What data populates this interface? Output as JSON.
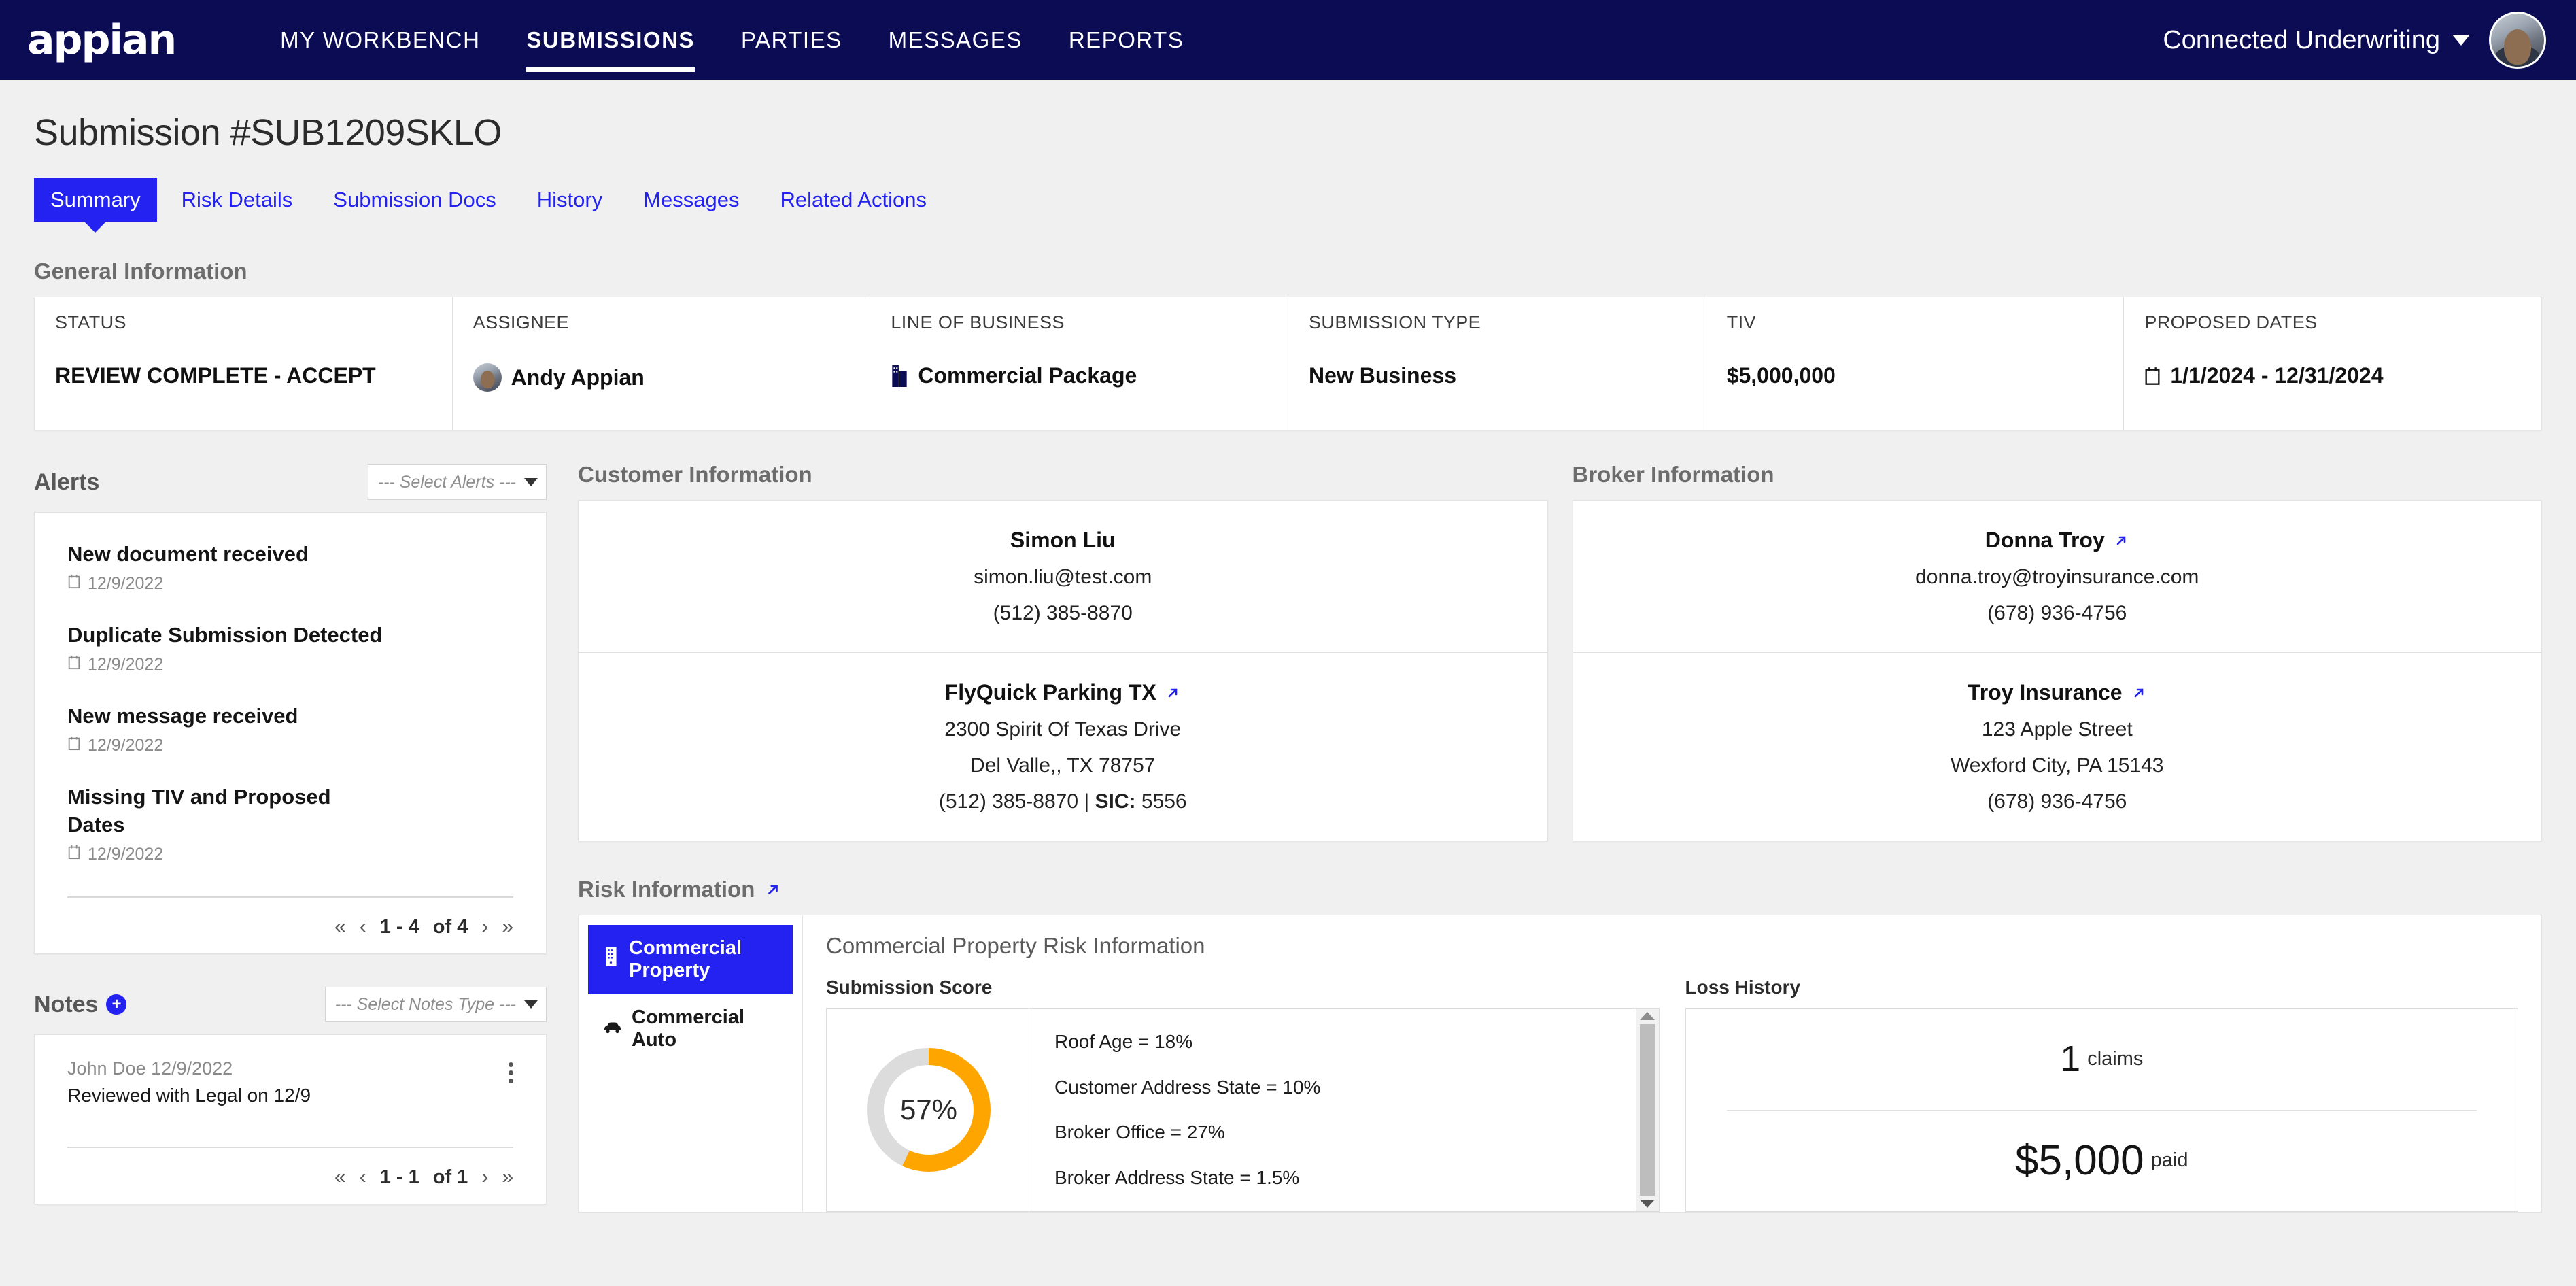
{
  "topnav": {
    "brand": "appian",
    "links": [
      {
        "label": "MY WORKBENCH",
        "active": false
      },
      {
        "label": "SUBMISSIONS",
        "active": true
      },
      {
        "label": "PARTIES",
        "active": false
      },
      {
        "label": "MESSAGES",
        "active": false
      },
      {
        "label": "REPORTS",
        "active": false
      }
    ],
    "user": "Connected Underwriting"
  },
  "page": {
    "title": "Submission #SUB1209SKLO",
    "tabs": [
      {
        "label": "Summary",
        "active": true
      },
      {
        "label": "Risk Details",
        "active": false
      },
      {
        "label": "Submission Docs",
        "active": false
      },
      {
        "label": "History",
        "active": false
      },
      {
        "label": "Messages",
        "active": false
      },
      {
        "label": "Related Actions",
        "active": false
      }
    ]
  },
  "general_information": {
    "heading": "General Information",
    "fields": [
      {
        "label": "STATUS",
        "value": "REVIEW COMPLETE - ACCEPT",
        "icon": ""
      },
      {
        "label": "ASSIGNEE",
        "value": "Andy Appian",
        "icon": "avatar"
      },
      {
        "label": "LINE OF BUSINESS",
        "value": "Commercial Package",
        "icon": "building-icon"
      },
      {
        "label": "SUBMISSION TYPE",
        "value": "New Business",
        "icon": ""
      },
      {
        "label": "TIV",
        "value": "$5,000,000",
        "icon": ""
      },
      {
        "label": "PROPOSED DATES",
        "value": "1/1/2024 - 12/31/2024",
        "icon": "calendar-icon"
      }
    ]
  },
  "alerts": {
    "title": "Alerts",
    "select_placeholder": "--- Select Alerts ---",
    "items": [
      {
        "title": "New document received",
        "date": "12/9/2022"
      },
      {
        "title": "Duplicate Submission Detected",
        "date": "12/9/2022"
      },
      {
        "title": "New message received",
        "date": "12/9/2022"
      },
      {
        "title": "Missing TIV and Proposed Dates",
        "date": "12/9/2022"
      }
    ],
    "pager": {
      "range": "1 - 4",
      "of": "of 4"
    }
  },
  "notes": {
    "title": "Notes",
    "select_placeholder": "--- Select Notes Type ---",
    "items": [
      {
        "meta": "John Doe 12/9/2022",
        "body": "Reviewed with Legal on 12/9"
      }
    ],
    "pager": {
      "range": "1 - 1",
      "of": "of 1"
    }
  },
  "customer_information": {
    "heading": "Customer Information",
    "contact": {
      "name": "Simon Liu",
      "email": "simon.liu@test.com",
      "phone": "(512) 385-8870"
    },
    "company": {
      "name": "FlyQuick Parking TX",
      "address1": "2300 Spirit Of Texas Drive",
      "address2": "Del Valle,, TX 78757",
      "phone": "(512) 385-8870",
      "sic_label": "SIC:",
      "sic_value": "5556"
    }
  },
  "broker_information": {
    "heading": "Broker Information",
    "contact": {
      "name": "Donna Troy",
      "email": "donna.troy@troyinsurance.com",
      "phone": "(678) 936-4756"
    },
    "company": {
      "name": "Troy Insurance",
      "address1": "123 Apple Street",
      "address2": "Wexford City, PA 15143",
      "phone": "(678) 936-4756"
    }
  },
  "risk_information": {
    "heading": "Risk Information",
    "tabs": [
      {
        "label": "Commercial Property",
        "icon": "building-icon",
        "active": true
      },
      {
        "label": "Commercial Auto",
        "icon": "car-icon",
        "active": false
      }
    ],
    "panel_title": "Commercial Property Risk Information",
    "submission_score_label": "Submission Score",
    "loss_history_label": "Loss History",
    "loss_history": {
      "claims_value": "1",
      "claims_unit": "claims",
      "paid_value": "$5,000",
      "paid_unit": "paid"
    }
  },
  "colors": {
    "nav_bg": "#0b0c54",
    "accent_blue": "#2322f0",
    "gauge_orange": "#ffa500",
    "gauge_track": "#dcdcdc",
    "page_bg": "#f0f0f0"
  },
  "chart_data": {
    "type": "pie",
    "title": "Submission Score",
    "center_label": "57%",
    "value": 57,
    "max": 100,
    "colors": {
      "filled": "#ffa500",
      "track": "#dcdcdc"
    },
    "legend_position": "right",
    "factors": [
      {
        "label": "Roof Age",
        "value": 18,
        "display": "Roof Age = 18%"
      },
      {
        "label": "Customer Address State",
        "value": 10,
        "display": "Customer Address State = 10%"
      },
      {
        "label": "Broker Office",
        "value": 27,
        "display": "Broker Office = 27%"
      },
      {
        "label": "Broker Address State",
        "value": 1.5,
        "display": "Broker Address State = 1.5%"
      }
    ]
  }
}
